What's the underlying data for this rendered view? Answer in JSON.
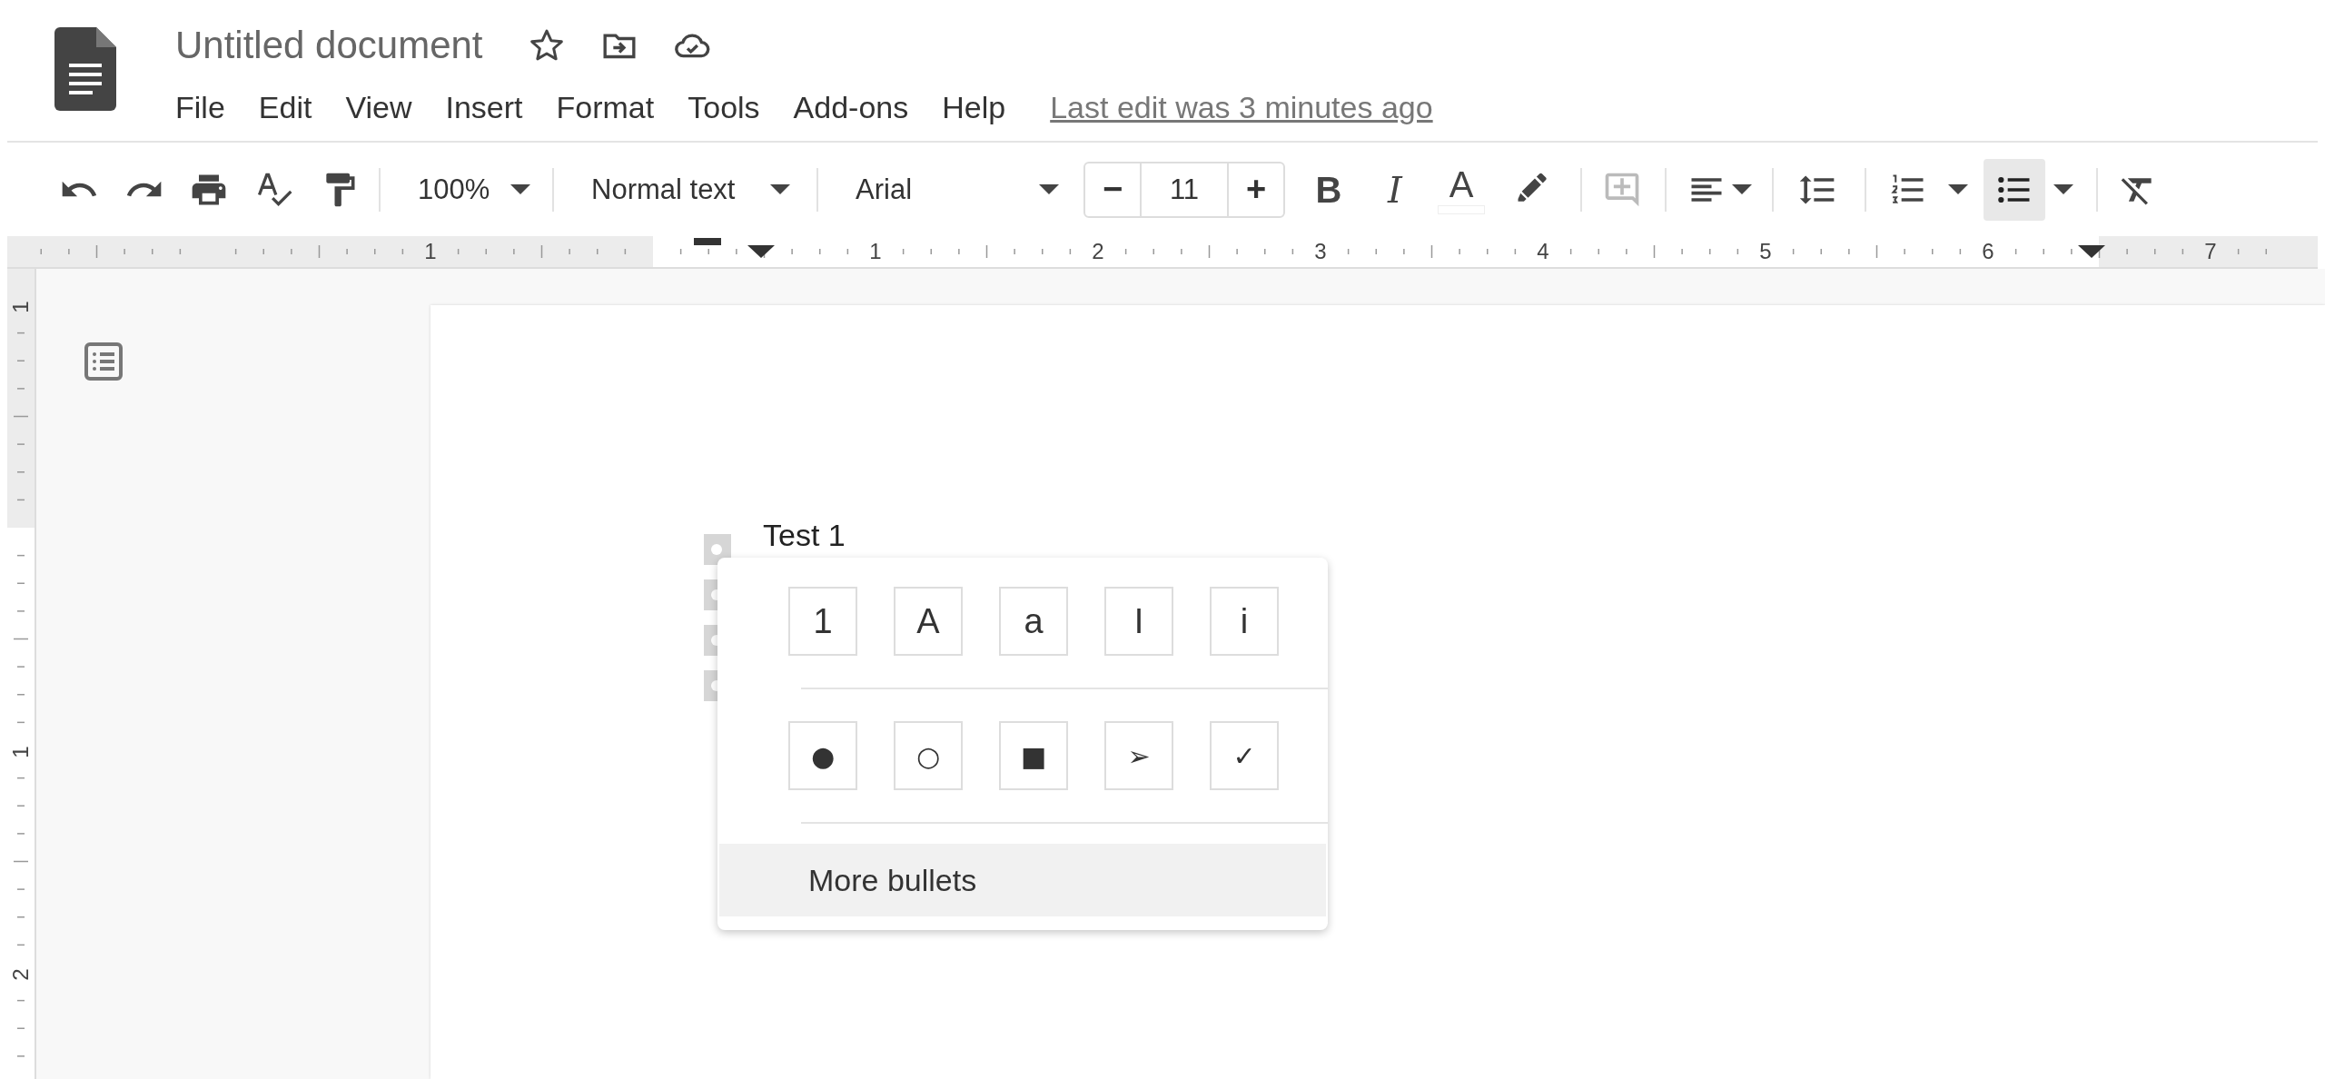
{
  "document_title": "Untitled document",
  "menu": [
    "File",
    "Edit",
    "View",
    "Insert",
    "Format",
    "Tools",
    "Add-ons",
    "Help"
  ],
  "last_edit": "Last edit was 3 minutes ago",
  "toolbar": {
    "zoom": "100%",
    "paragraph_style": "Normal text",
    "font": "Arial",
    "font_size": {
      "decrease": "−",
      "value": "11",
      "increase": "+"
    },
    "format_buttons": [
      {
        "kind": "bold",
        "label": "B"
      },
      {
        "kind": "italic",
        "label": "I"
      },
      {
        "kind": "text-color",
        "label": "A"
      }
    ],
    "add_comment": {
      "disabled": true
    },
    "bulleted_list": {
      "selected": true
    }
  },
  "ruler": {
    "horizontal": [
      "1",
      "1",
      "2",
      "3",
      "4",
      "5",
      "6",
      "7"
    ],
    "vertical": [
      "1",
      "1",
      "2"
    ]
  },
  "document": {
    "list_items": [
      {
        "text": "Test 1",
        "selected": true
      },
      {
        "selected": true
      },
      {
        "selected": true
      },
      {
        "selected": true
      }
    ]
  },
  "list_menu": {
    "numbered": [
      "1",
      "A",
      "a",
      "I",
      "i"
    ],
    "bullets": [
      "●",
      "○",
      "■",
      "➢",
      "✓"
    ],
    "more": {
      "label": "More bullets",
      "highlighted": true
    }
  }
}
